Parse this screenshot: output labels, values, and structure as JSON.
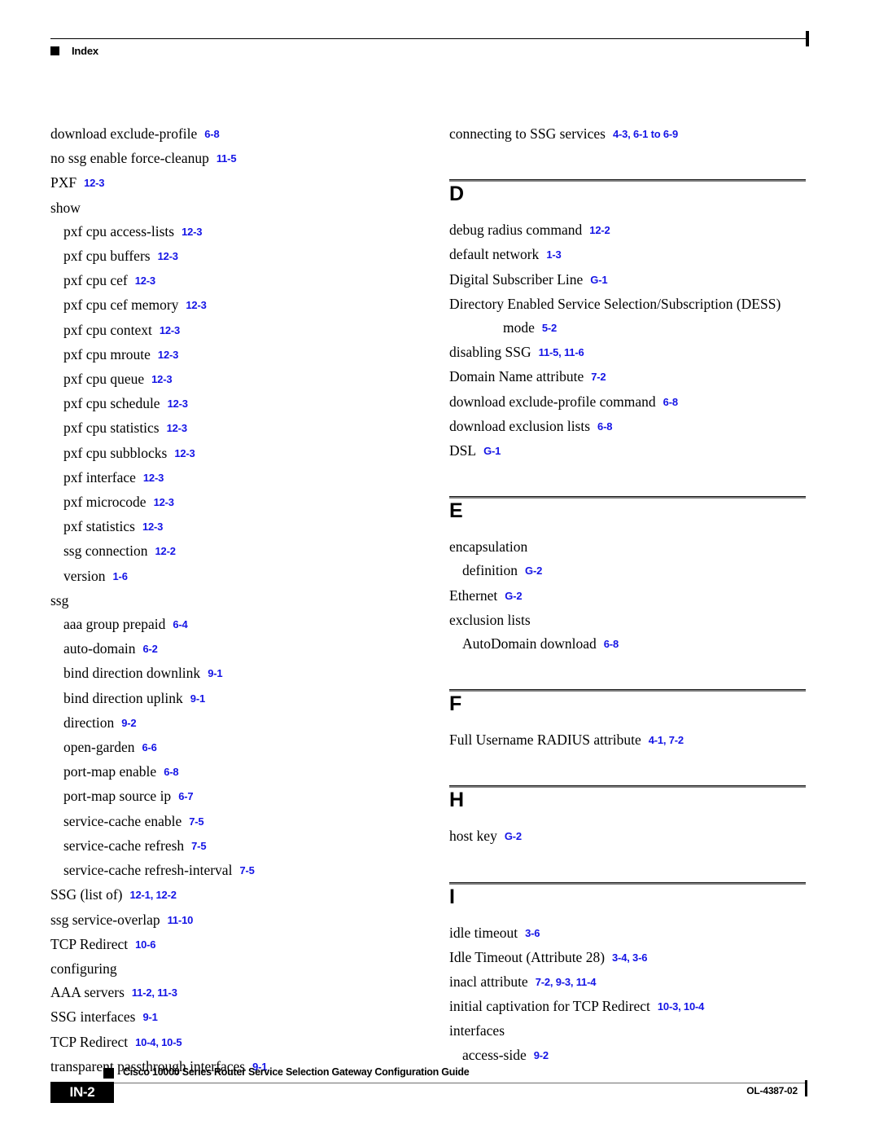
{
  "header": {
    "title": "Index"
  },
  "left_column": [
    {
      "level": 0,
      "term": "download exclude-profile",
      "refs": "6-8"
    },
    {
      "level": 0,
      "term": "no ssg enable force-cleanup",
      "refs": "11-5"
    },
    {
      "level": 0,
      "term": "PXF",
      "refs": "12-3"
    },
    {
      "level": 0,
      "term": "show",
      "refs": ""
    },
    {
      "level": 1,
      "term": "pxf cpu access-lists",
      "refs": "12-3"
    },
    {
      "level": 1,
      "term": "pxf cpu buffers",
      "refs": "12-3"
    },
    {
      "level": 1,
      "term": "pxf cpu cef",
      "refs": "12-3"
    },
    {
      "level": 1,
      "term": "pxf cpu cef memory",
      "refs": "12-3"
    },
    {
      "level": 1,
      "term": "pxf cpu context",
      "refs": "12-3"
    },
    {
      "level": 1,
      "term": "pxf cpu mroute",
      "refs": "12-3"
    },
    {
      "level": 1,
      "term": "pxf cpu queue",
      "refs": "12-3"
    },
    {
      "level": 1,
      "term": "pxf cpu schedule",
      "refs": "12-3"
    },
    {
      "level": 1,
      "term": "pxf cpu statistics",
      "refs": "12-3"
    },
    {
      "level": 1,
      "term": "pxf cpu subblocks",
      "refs": "12-3"
    },
    {
      "level": 1,
      "term": "pxf interface",
      "refs": "12-3"
    },
    {
      "level": 1,
      "term": "pxf microcode",
      "refs": "12-3"
    },
    {
      "level": 1,
      "term": "pxf statistics",
      "refs": "12-3"
    },
    {
      "level": 1,
      "term": "ssg connection",
      "refs": "12-2"
    },
    {
      "level": 1,
      "term": "version",
      "refs": "1-6"
    },
    {
      "level": 0,
      "term": "ssg",
      "refs": ""
    },
    {
      "level": 1,
      "term": "aaa group prepaid",
      "refs": "6-4"
    },
    {
      "level": 1,
      "term": "auto-domain",
      "refs": "6-2"
    },
    {
      "level": 1,
      "term": "bind direction downlink",
      "refs": "9-1"
    },
    {
      "level": 1,
      "term": "bind direction uplink",
      "refs": "9-1"
    },
    {
      "level": 1,
      "term": "direction",
      "refs": "9-2"
    },
    {
      "level": 1,
      "term": "open-garden",
      "refs": "6-6"
    },
    {
      "level": 1,
      "term": "port-map enable",
      "refs": "6-8"
    },
    {
      "level": 1,
      "term": "port-map source ip",
      "refs": "6-7"
    },
    {
      "level": 1,
      "term": "service-cache enable",
      "refs": "7-5"
    },
    {
      "level": 1,
      "term": "service-cache refresh",
      "refs": "7-5"
    },
    {
      "level": 1,
      "term": "service-cache refresh-interval",
      "refs": "7-5"
    },
    {
      "level": 0,
      "term": "SSG (list of)",
      "refs": "12-1, 12-2"
    },
    {
      "level": 0,
      "term": "ssg service-overlap",
      "refs": "11-10"
    },
    {
      "level": 0,
      "term": "TCP Redirect",
      "refs": "10-6"
    },
    {
      "level": 0,
      "term": "configuring",
      "refs": "",
      "outdent": true
    },
    {
      "level": 0,
      "term": "AAA servers",
      "refs": "11-2, 11-3"
    },
    {
      "level": 0,
      "term": "SSG interfaces",
      "refs": "9-1"
    },
    {
      "level": 0,
      "term": "TCP Redirect",
      "refs": "10-4, 10-5"
    },
    {
      "level": 0,
      "term": "transparent passthrough interfaces",
      "refs": "9-1"
    }
  ],
  "right_column": {
    "intro_entries": [
      {
        "level": 0,
        "term": "connecting to SSG services",
        "refs": "4-3, 6-1 to 6-9"
      }
    ],
    "sections": [
      {
        "letter": "D",
        "entries": [
          {
            "level": 0,
            "term": "debug radius command",
            "refs": "12-2"
          },
          {
            "level": 0,
            "term": "default network",
            "refs": "1-3"
          },
          {
            "level": 0,
            "term": "Digital Subscriber Line",
            "refs": "G-1"
          },
          {
            "level": 0,
            "term": "Directory Enabled Service Selection/Subscription (DESS)",
            "refs": ""
          },
          {
            "level": 3,
            "term": "mode",
            "refs": "5-2"
          },
          {
            "level": 0,
            "term": "disabling SSG",
            "refs": "11-5, 11-6"
          },
          {
            "level": 0,
            "term": "Domain Name attribute",
            "refs": "7-2"
          },
          {
            "level": 0,
            "term": "download exclude-profile command",
            "refs": "6-8"
          },
          {
            "level": 0,
            "term": "download exclusion lists",
            "refs": "6-8"
          },
          {
            "level": 0,
            "term": "DSL",
            "refs": "G-1"
          }
        ]
      },
      {
        "letter": "E",
        "entries": [
          {
            "level": 0,
            "term": "encapsulation",
            "refs": ""
          },
          {
            "level": 1,
            "term": "definition",
            "refs": "G-2"
          },
          {
            "level": 0,
            "term": "Ethernet",
            "refs": "G-2"
          },
          {
            "level": 0,
            "term": "exclusion lists",
            "refs": ""
          },
          {
            "level": 1,
            "term": "AutoDomain download",
            "refs": "6-8"
          }
        ]
      },
      {
        "letter": "F",
        "entries": [
          {
            "level": 0,
            "term": "Full Username RADIUS attribute",
            "refs": "4-1, 7-2"
          }
        ]
      },
      {
        "letter": "H",
        "entries": [
          {
            "level": 0,
            "term": "host key",
            "refs": "G-2"
          }
        ]
      },
      {
        "letter": "I",
        "entries": [
          {
            "level": 0,
            "term": "idle timeout",
            "refs": "3-6"
          },
          {
            "level": 0,
            "term": "Idle Timeout (Attribute 28)",
            "refs": "3-4, 3-6"
          },
          {
            "level": 0,
            "term": "inacl attribute",
            "refs": "7-2, 9-3, 11-4"
          },
          {
            "level": 0,
            "term": "initial captivation for TCP Redirect",
            "refs": "10-3, 10-4"
          },
          {
            "level": 0,
            "term": "interfaces",
            "refs": ""
          },
          {
            "level": 1,
            "term": "access-side",
            "refs": "9-2"
          }
        ]
      }
    ]
  },
  "footer": {
    "page_number": "IN-2",
    "guide_title": "Cisco 10000 Series Router Service Selection Gateway Configuration Guide",
    "doc_id": "OL-4387-02"
  },
  "colors": {
    "page_reference_blue": "#1414E6",
    "text_black": "#000000",
    "rule_gray": "#808080"
  }
}
